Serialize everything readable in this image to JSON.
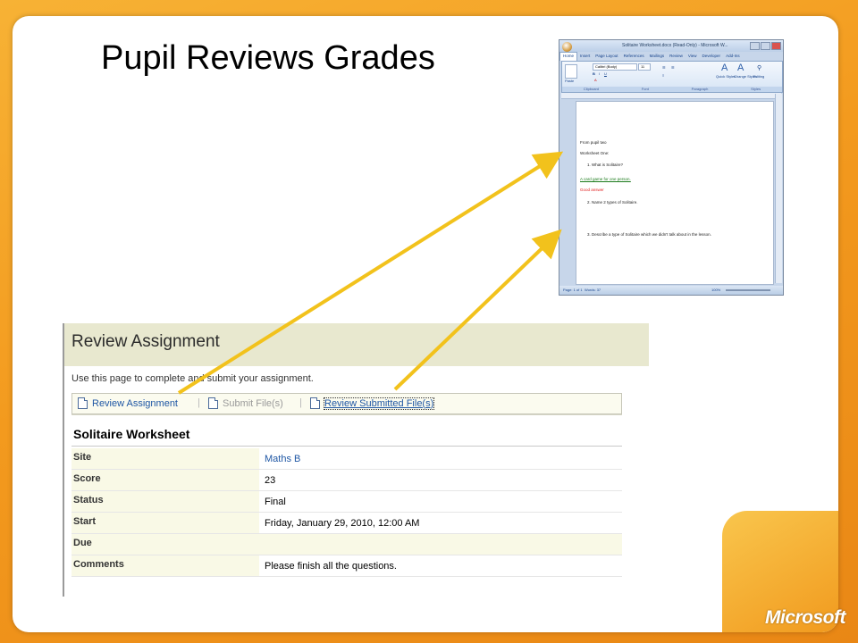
{
  "slide": {
    "title": "Pupil Reviews Grades",
    "brand": "Microsoft"
  },
  "word_window": {
    "title": "Solitaire Worksheet.docx (Read-Only) - Microsoft W...",
    "tabs": [
      "Home",
      "Insert",
      "Page Layout",
      "References",
      "Mailings",
      "Review",
      "View",
      "Developer",
      "Add-Ins"
    ],
    "ribbon": {
      "paste": "Paste",
      "font": "Calibri (Body)",
      "size": "11",
      "quick_styles": "Quick Styles",
      "change_styles": "Change Styles",
      "editing": "Editing",
      "groups": [
        "Clipboard",
        "Font",
        "Paragraph",
        "Styles"
      ]
    },
    "document_lines": [
      "From pupil two",
      "Worksheet One:",
      "1.    What is Solitaire?",
      "A card game for one person.",
      "Good answer",
      "2.    Name 2 types of Solitaire.",
      "3.    Describe a type of Solitaire which we didn't talk about in the lesson."
    ],
    "status": {
      "page": "Page: 1 of 1",
      "words": "Words: 37",
      "zoom": "100%"
    }
  },
  "review": {
    "header": "Review Assignment",
    "intro": "Use this page to complete and submit your assignment.",
    "toolbar": {
      "review_assignment": "Review Assignment",
      "submit_files": "Submit File(s)",
      "review_submitted": "Review Submitted File(s)",
      "separator": "|"
    },
    "assignment_title": "Solitaire Worksheet",
    "rows": [
      {
        "label": "Site",
        "value": "Maths B"
      },
      {
        "label": "Score",
        "value": "23"
      },
      {
        "label": "Status",
        "value": "Final"
      },
      {
        "label": "Start",
        "value": "Friday, January 29, 2010, 12:00 AM"
      },
      {
        "label": "Due",
        "value": ""
      },
      {
        "label": "Comments",
        "value": "Please finish all the questions."
      }
    ]
  },
  "colors": {
    "arrow": "#f2c21c",
    "header_bg": "#e8e8cf",
    "link": "#1f57a4",
    "background": "#f29b1d"
  }
}
